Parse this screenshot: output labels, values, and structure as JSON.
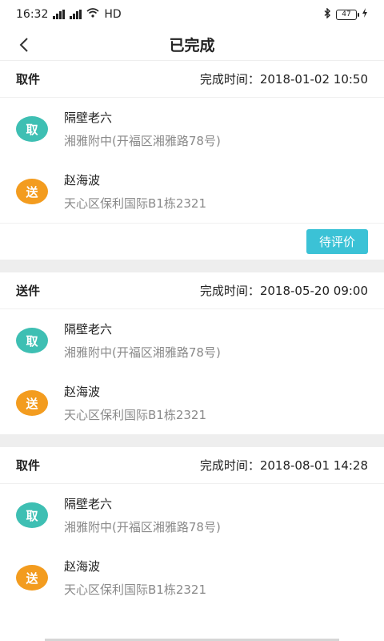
{
  "status": {
    "time": "16:32",
    "network": "HD",
    "battery": "47"
  },
  "nav": {
    "title": "已完成"
  },
  "labels": {
    "time_prefix": "完成时间：",
    "pickup_badge": "取",
    "send_badge": "送"
  },
  "orders": [
    {
      "type": "取件",
      "time": "2018-01-02 10:50",
      "pickup": {
        "name": "隔壁老六",
        "address": "湘雅附中(开福区湘雅路78号)"
      },
      "delivery": {
        "name": "赵海波",
        "address": "天心区保利国际B1栋2321"
      },
      "action": "待评价"
    },
    {
      "type": "送件",
      "time": "2018-05-20 09:00",
      "pickup": {
        "name": "隔壁老六",
        "address": "湘雅附中(开福区湘雅路78号)"
      },
      "delivery": {
        "name": "赵海波",
        "address": "天心区保利国际B1栋2321"
      }
    },
    {
      "type": "取件",
      "time": "2018-08-01 14:28",
      "pickup": {
        "name": "隔壁老六",
        "address": "湘雅附中(开福区湘雅路78号)"
      },
      "delivery": {
        "name": "赵海波",
        "address": "天心区保利国际B1栋2321"
      }
    }
  ]
}
